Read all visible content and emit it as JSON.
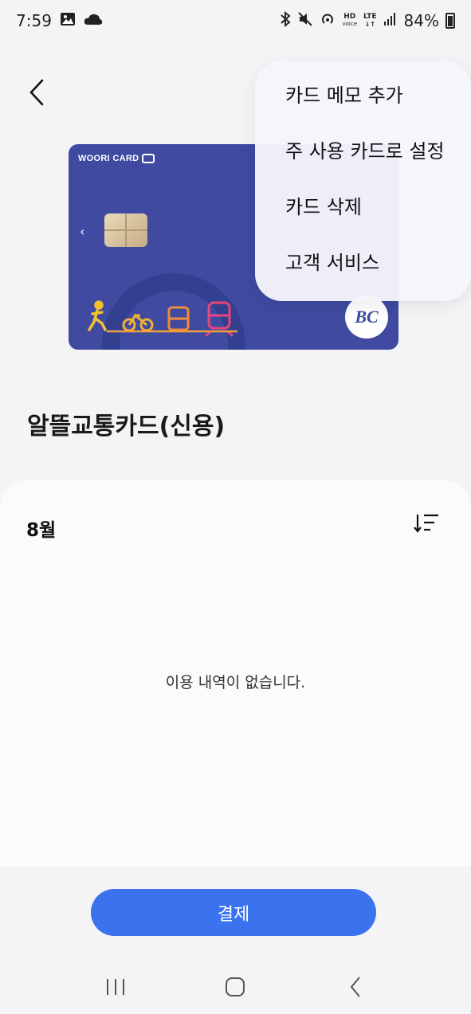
{
  "status_bar": {
    "time": "7:59",
    "battery": "84%",
    "hd_top": "HD",
    "hd_bottom": "voice",
    "lte": "LTE",
    "icons": [
      "gallery-icon",
      "cloud-icon",
      "bluetooth-icon",
      "mute-icon",
      "hotspot-icon",
      "signal-icon",
      "battery-icon"
    ]
  },
  "card": {
    "brand": "WOORI CARD",
    "issuer_logo": "BC",
    "colors": {
      "background": "#3f4aa0",
      "accent_yellow": "#f2c12e",
      "accent_orange": "#f08a3c",
      "accent_pink": "#e8467a"
    }
  },
  "menu": {
    "items": [
      {
        "label": "카드 메모 추가"
      },
      {
        "label": "주 사용 카드로 설정"
      },
      {
        "label": "카드 삭제"
      },
      {
        "label": "고객 서비스"
      }
    ]
  },
  "title": "알뜰교통카드(신용)",
  "history": {
    "month": "8월",
    "empty_message": "이용 내역이 없습니다."
  },
  "pay_button": {
    "label": "결제",
    "color": "#3b72ee"
  }
}
